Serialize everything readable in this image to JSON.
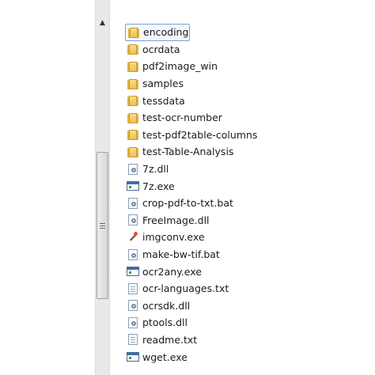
{
  "scrollbar": {
    "up_arrow": "▲"
  },
  "files": [
    {
      "name": "encoding",
      "type": "folder",
      "selected": true,
      "icon": "folder-icon"
    },
    {
      "name": "ocrdata",
      "type": "folder",
      "icon": "folder-icon"
    },
    {
      "name": "pdf2image_win",
      "type": "folder",
      "icon": "folder-icon"
    },
    {
      "name": "samples",
      "type": "folder",
      "icon": "folder-icon"
    },
    {
      "name": "tessdata",
      "type": "folder",
      "icon": "folder-icon"
    },
    {
      "name": "test-ocr-number",
      "type": "folder",
      "icon": "folder-icon"
    },
    {
      "name": "test-pdf2table-columns",
      "type": "folder",
      "icon": "folder-icon"
    },
    {
      "name": "test-Table-Analysis",
      "type": "folder",
      "icon": "folder-icon"
    },
    {
      "name": "7z.dll",
      "type": "dll",
      "icon": "dll-file-icon"
    },
    {
      "name": "7z.exe",
      "type": "exe",
      "icon": "exe-file-icon"
    },
    {
      "name": "crop-pdf-to-txt.bat",
      "type": "bat",
      "icon": "batch-file-icon"
    },
    {
      "name": "FreeImage.dll",
      "type": "dll",
      "icon": "dll-file-icon"
    },
    {
      "name": "imgconv.exe",
      "type": "wand",
      "icon": "magic-wand-icon"
    },
    {
      "name": "make-bw-tif.bat",
      "type": "bat",
      "icon": "batch-file-icon"
    },
    {
      "name": "ocr2any.exe",
      "type": "exe",
      "icon": "exe-file-icon"
    },
    {
      "name": "ocr-languages.txt",
      "type": "txt",
      "icon": "text-file-icon"
    },
    {
      "name": "ocrsdk.dll",
      "type": "dll",
      "icon": "dll-file-icon"
    },
    {
      "name": "ptools.dll",
      "type": "dll",
      "icon": "dll-file-icon"
    },
    {
      "name": "readme.txt",
      "type": "txt",
      "icon": "text-file-icon"
    },
    {
      "name": "wget.exe",
      "type": "exe",
      "icon": "exe-file-icon"
    }
  ]
}
